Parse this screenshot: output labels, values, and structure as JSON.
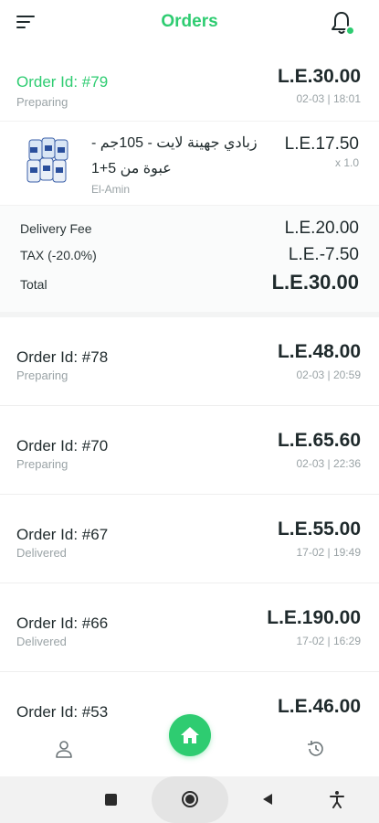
{
  "header": {
    "title": "Orders",
    "menu_icon": "menu-icon",
    "notification_icon": "bell-icon"
  },
  "colors": {
    "accent": "#2ecc71",
    "text": "#1f2a2c",
    "muted": "#9aa3a6"
  },
  "expanded_order": {
    "id_label": "Order Id: #79",
    "status": "Preparing",
    "amount": "L.E.30.00",
    "date": "02-03 | 18:01",
    "item": {
      "name": "زبادي جهينة لايت - 105جم - عبوة من 5+1",
      "vendor": "El-Amin",
      "price": "L.E.17.50",
      "quantity": "x 1.0"
    },
    "summary": {
      "delivery_label": "Delivery Fee",
      "delivery_value": "L.E.20.00",
      "tax_label": "TAX (-20.0%)",
      "tax_value": "L.E.-7.50",
      "total_label": "Total",
      "total_value": "L.E.30.00"
    }
  },
  "orders": [
    {
      "id_label": "Order Id: #78",
      "status": "Preparing",
      "amount": "L.E.48.00",
      "date": "02-03 | 20:59"
    },
    {
      "id_label": "Order Id: #70",
      "status": "Preparing",
      "amount": "L.E.65.60",
      "date": "02-03 | 22:36"
    },
    {
      "id_label": "Order Id: #67",
      "status": "Delivered",
      "amount": "L.E.55.00",
      "date": "17-02 | 19:49"
    },
    {
      "id_label": "Order Id: #66",
      "status": "Delivered",
      "amount": "L.E.190.00",
      "date": "17-02 | 16:29"
    },
    {
      "id_label": "Order Id: #53",
      "status": "",
      "amount": "L.E.46.00",
      "date": ""
    }
  ],
  "bottom_nav": {
    "profile_icon": "user-icon",
    "home_icon": "home-icon",
    "history_icon": "history-icon"
  },
  "system_bar": {
    "recents_icon": "square-icon",
    "home_icon": "circle-icon",
    "back_icon": "back-triangle-icon",
    "accessibility_icon": "accessibility-icon"
  }
}
